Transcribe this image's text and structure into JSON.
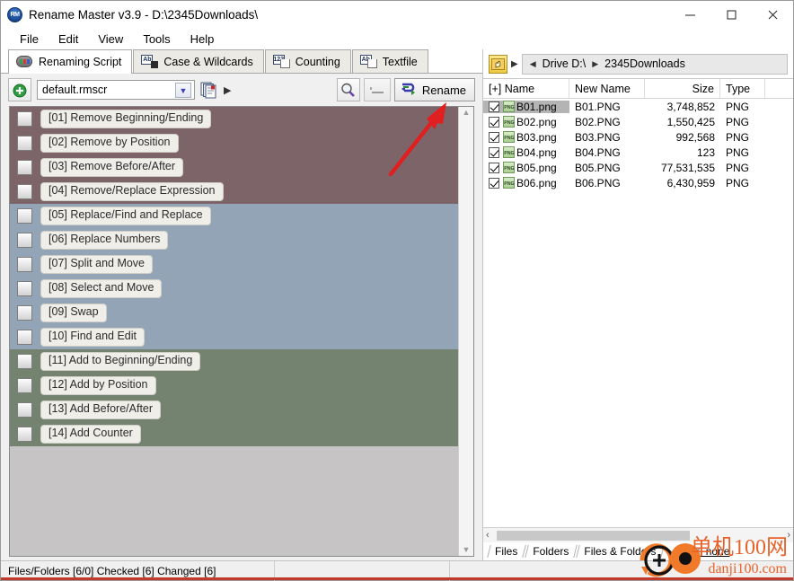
{
  "window": {
    "title": "Rename Master v3.9 - D:\\2345Downloads\\",
    "logo_icon": "rm-logo-icon",
    "minimize_icon": "minimize-icon",
    "maximize_icon": "maximize-icon",
    "close_icon": "close-icon"
  },
  "menu": [
    {
      "label": "File"
    },
    {
      "label": "Edit"
    },
    {
      "label": "View"
    },
    {
      "label": "Tools"
    },
    {
      "label": "Help"
    }
  ],
  "tabs": [
    {
      "label": "Renaming Script",
      "icon": "script-icon",
      "active": true
    },
    {
      "label": "Case & Wildcards",
      "icon": "ab-box-icon",
      "active": false
    },
    {
      "label": "Counting",
      "icon": "123-icon",
      "active": false
    },
    {
      "label": "Textfile",
      "icon": "ab-page-icon",
      "active": false
    }
  ],
  "script_toolbar": {
    "add_script_icon": "add-green-plus-icon",
    "script_file": "default.rmscr",
    "combo_arrow_icon": "combo-dropdown-arrow-icon",
    "script_stack_icon": "script-stack-icon",
    "script_stack_play_icon": "play-triangle-icon",
    "preview_icon": "magnifier-preview-icon",
    "undo_icon": "undo-dash-icon",
    "rename_label": "Rename",
    "rename_icon": "rename-arrows-icon"
  },
  "script_items": [
    {
      "num": "[01]",
      "label": "[01]  Remove Beginning/Ending",
      "group": "remove",
      "checked": false
    },
    {
      "num": "[02]",
      "label": "[02]  Remove by Position",
      "group": "remove",
      "checked": false
    },
    {
      "num": "[03]",
      "label": "[03]  Remove Before/After",
      "group": "remove",
      "checked": false
    },
    {
      "num": "[04]",
      "label": "[04]  Remove/Replace Expression",
      "group": "remove",
      "checked": false
    },
    {
      "num": "[05]",
      "label": "[05]  Replace/Find and Replace",
      "group": "replace",
      "checked": false
    },
    {
      "num": "[06]",
      "label": "[06]  Replace Numbers",
      "group": "replace",
      "checked": false
    },
    {
      "num": "[07]",
      "label": "[07]  Split and Move",
      "group": "replace",
      "checked": false
    },
    {
      "num": "[08]",
      "label": "[08]  Select and Move",
      "group": "replace",
      "checked": false
    },
    {
      "num": "[09]",
      "label": "[09]  Swap",
      "group": "replace",
      "checked": false
    },
    {
      "num": "[10]",
      "label": "[10]  Find and Edit",
      "group": "replace",
      "checked": false
    },
    {
      "num": "[11]",
      "label": "[11]  Add to Beginning/Ending",
      "group": "add",
      "checked": false
    },
    {
      "num": "[12]",
      "label": "[12]  Add by Position",
      "group": "add",
      "checked": false
    },
    {
      "num": "[13]",
      "label": "[13]  Add Before/After",
      "group": "add",
      "checked": false
    },
    {
      "num": "[14]",
      "label": "[14]  Add Counter",
      "group": "add",
      "checked": false
    }
  ],
  "script_scrollbar": {
    "up_icon": "scroll-up-arrow-icon",
    "down_icon": "scroll-down-arrow-icon"
  },
  "navigation": {
    "folder_icon": "folder-hand-icon",
    "play_icon": "nav-play-icon",
    "back_icon": "nav-back-arrow-icon",
    "drive": "Drive D:\\",
    "forward_icon": "nav-forward-arrow-icon",
    "folder": "2345Downloads"
  },
  "filelist": {
    "columns": [
      {
        "label": "[+] Name",
        "width": 96
      },
      {
        "label": "New Name",
        "width": 84
      },
      {
        "label": "Size",
        "width": 84,
        "align": "right"
      },
      {
        "label": "Type",
        "width": 50
      },
      {
        "label": "",
        "width": 30
      }
    ],
    "rows": [
      {
        "checked": true,
        "icon": "png-file-icon",
        "name": "B01.png",
        "new_name": "B01.PNG",
        "size": "3,748,852",
        "type": "PNG",
        "selected": true
      },
      {
        "checked": true,
        "icon": "png-file-icon",
        "name": "B02.png",
        "new_name": "B02.PNG",
        "size": "1,550,425",
        "type": "PNG",
        "selected": false
      },
      {
        "checked": true,
        "icon": "png-file-icon",
        "name": "B03.png",
        "new_name": "B03.PNG",
        "size": "992,568",
        "type": "PNG",
        "selected": false
      },
      {
        "checked": true,
        "icon": "png-file-icon",
        "name": "B04.png",
        "new_name": "B04.PNG",
        "size": "123",
        "type": "PNG",
        "selected": false
      },
      {
        "checked": true,
        "icon": "png-file-icon",
        "name": "B05.png",
        "new_name": "B05.PNG",
        "size": "77,531,535",
        "type": "PNG",
        "selected": false
      },
      {
        "checked": true,
        "icon": "png-file-icon",
        "name": "B06.png",
        "new_name": "B06.PNG",
        "size": "6,430,959",
        "type": "PNG",
        "selected": false
      }
    ],
    "hscroll": {
      "left_icon": "hscroll-left-arrow-icon",
      "right_icon": "hscroll-right-arrow-icon"
    }
  },
  "filter_tabs": [
    {
      "label": "Files"
    },
    {
      "label": "Folders"
    },
    {
      "label": "Files & Folders"
    }
  ],
  "filter": {
    "label": "Filter: none"
  },
  "statusbar": {
    "left": "Files/Folders [6/0] Checked [6] Changed [6]",
    "middle": "",
    "right": ""
  },
  "annotation": {
    "arrow_icon": "red-pointer-arrow-icon"
  },
  "watermark": {
    "chinese": "单机100网",
    "url": "danji100.com",
    "logo_icon": "danji100-logo-icon",
    "accent_color": "#e8622a"
  },
  "colors": {
    "group_remove": "#7d6468",
    "group_replace": "#92a4b5",
    "group_add": "#74836f",
    "selection": "#b4b4b4",
    "annotation_red": "#e02020"
  }
}
